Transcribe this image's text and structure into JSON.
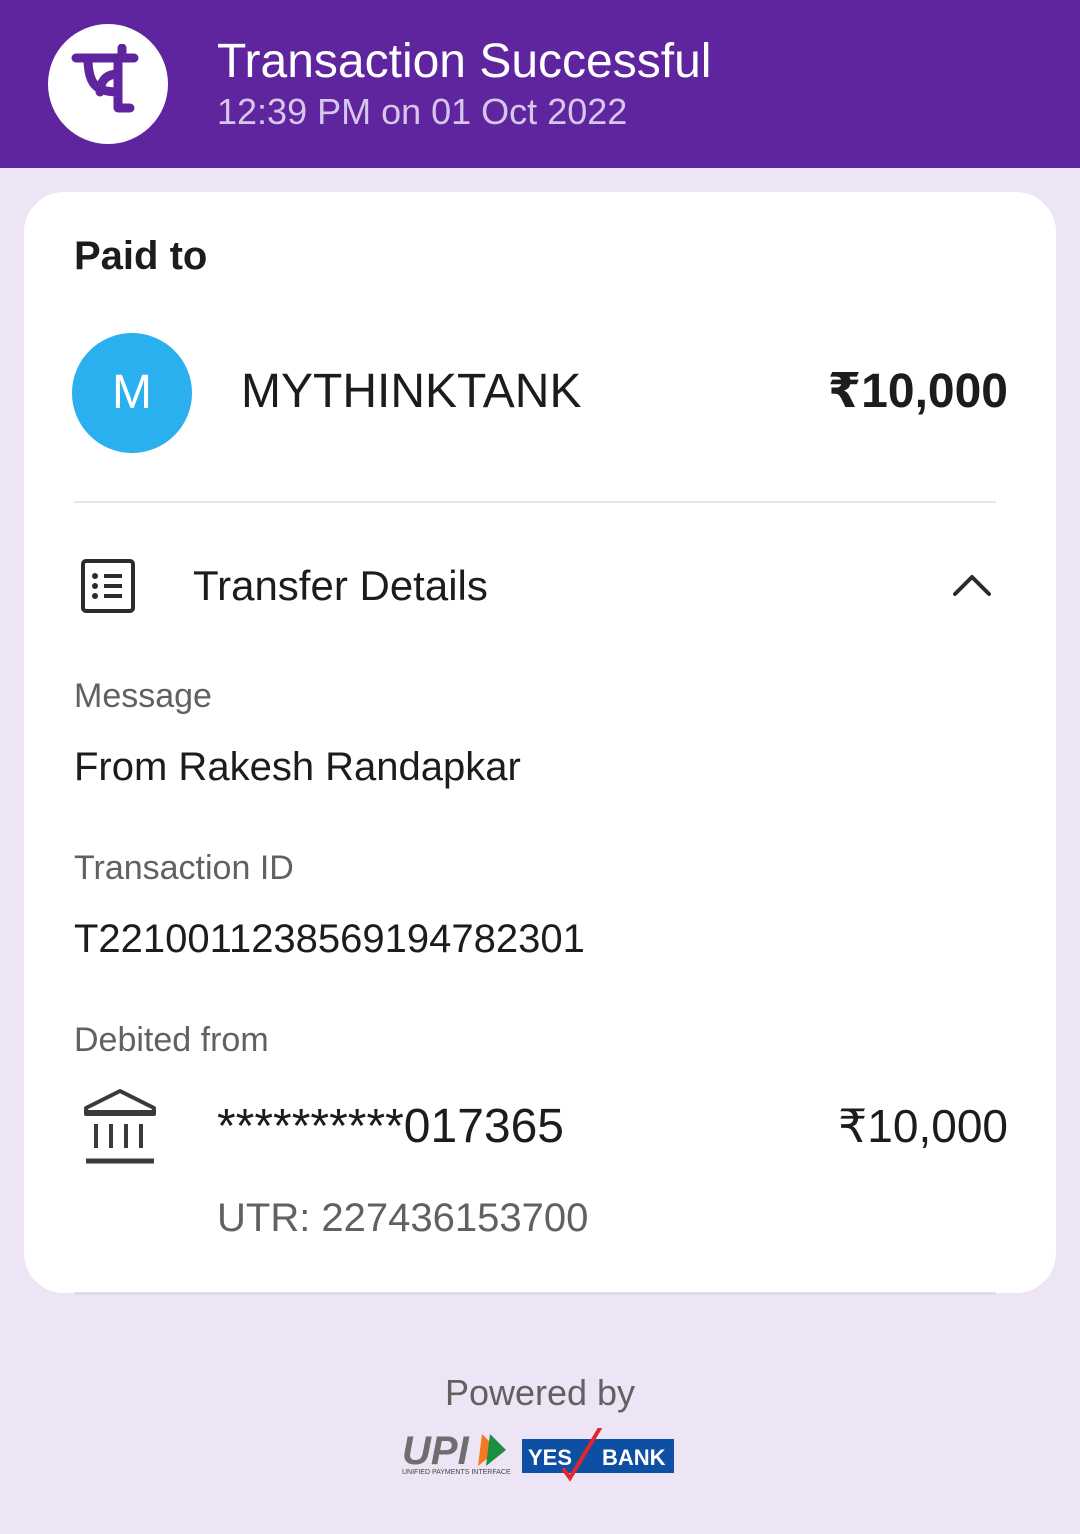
{
  "header": {
    "title": "Transaction Successful",
    "timestamp": "12:39 PM on 01 Oct 2022",
    "logo_icon": "phonepe-logo-icon",
    "background_color": "#5f259f"
  },
  "card": {
    "paid_to_label": "Paid to",
    "payee": {
      "initial": "M",
      "name": "MYTHINKTANK",
      "amount": "₹10,000",
      "avatar_color": "#2ab0ef"
    },
    "transfer_details": {
      "title": "Transfer Details",
      "icon": "receipt-list-icon",
      "toggle_icon": "chevron-up-icon",
      "message_label": "Message",
      "message_value": "From Rakesh Randapkar",
      "transaction_id_label": "Transaction ID",
      "transaction_id_value": "T2210011238569194782301",
      "debited_from_label": "Debited from",
      "account": "**********017365",
      "debited_amount": "₹10,000",
      "utr": "UTR: 227436153700",
      "bank_icon": "bank-building-icon"
    }
  },
  "footer": {
    "powered_by": "Powered by",
    "upi_logo_text": "UPI",
    "upi_tagline": "UNIFIED PAYMENTS INTERFACE",
    "yes_bank_left": "YES",
    "yes_bank_right": "BANK"
  },
  "colors": {
    "page_background": "#ede4f6",
    "card_background": "#ffffff",
    "yes_bank_blue": "#0d4fa3",
    "yes_bank_red": "#e4262b"
  }
}
